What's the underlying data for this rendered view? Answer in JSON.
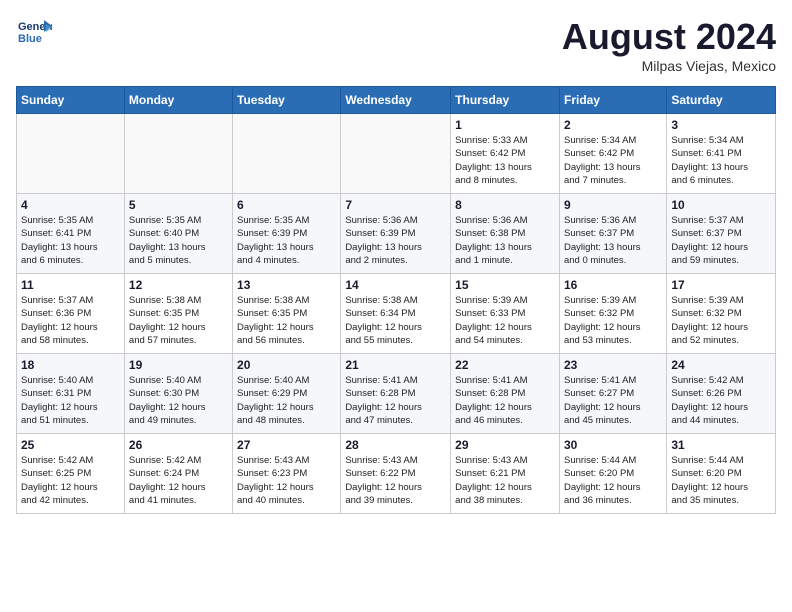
{
  "header": {
    "logo_text_line1": "General",
    "logo_text_line2": "Blue",
    "main_title": "August 2024",
    "subtitle": "Milpas Viejas, Mexico"
  },
  "days_of_week": [
    "Sunday",
    "Monday",
    "Tuesday",
    "Wednesday",
    "Thursday",
    "Friday",
    "Saturday"
  ],
  "weeks": [
    [
      {
        "num": "",
        "info": ""
      },
      {
        "num": "",
        "info": ""
      },
      {
        "num": "",
        "info": ""
      },
      {
        "num": "",
        "info": ""
      },
      {
        "num": "1",
        "info": "Sunrise: 5:33 AM\nSunset: 6:42 PM\nDaylight: 13 hours\nand 8 minutes."
      },
      {
        "num": "2",
        "info": "Sunrise: 5:34 AM\nSunset: 6:42 PM\nDaylight: 13 hours\nand 7 minutes."
      },
      {
        "num": "3",
        "info": "Sunrise: 5:34 AM\nSunset: 6:41 PM\nDaylight: 13 hours\nand 6 minutes."
      }
    ],
    [
      {
        "num": "4",
        "info": "Sunrise: 5:35 AM\nSunset: 6:41 PM\nDaylight: 13 hours\nand 6 minutes."
      },
      {
        "num": "5",
        "info": "Sunrise: 5:35 AM\nSunset: 6:40 PM\nDaylight: 13 hours\nand 5 minutes."
      },
      {
        "num": "6",
        "info": "Sunrise: 5:35 AM\nSunset: 6:39 PM\nDaylight: 13 hours\nand 4 minutes."
      },
      {
        "num": "7",
        "info": "Sunrise: 5:36 AM\nSunset: 6:39 PM\nDaylight: 13 hours\nand 2 minutes."
      },
      {
        "num": "8",
        "info": "Sunrise: 5:36 AM\nSunset: 6:38 PM\nDaylight: 13 hours\nand 1 minute."
      },
      {
        "num": "9",
        "info": "Sunrise: 5:36 AM\nSunset: 6:37 PM\nDaylight: 13 hours\nand 0 minutes."
      },
      {
        "num": "10",
        "info": "Sunrise: 5:37 AM\nSunset: 6:37 PM\nDaylight: 12 hours\nand 59 minutes."
      }
    ],
    [
      {
        "num": "11",
        "info": "Sunrise: 5:37 AM\nSunset: 6:36 PM\nDaylight: 12 hours\nand 58 minutes."
      },
      {
        "num": "12",
        "info": "Sunrise: 5:38 AM\nSunset: 6:35 PM\nDaylight: 12 hours\nand 57 minutes."
      },
      {
        "num": "13",
        "info": "Sunrise: 5:38 AM\nSunset: 6:35 PM\nDaylight: 12 hours\nand 56 minutes."
      },
      {
        "num": "14",
        "info": "Sunrise: 5:38 AM\nSunset: 6:34 PM\nDaylight: 12 hours\nand 55 minutes."
      },
      {
        "num": "15",
        "info": "Sunrise: 5:39 AM\nSunset: 6:33 PM\nDaylight: 12 hours\nand 54 minutes."
      },
      {
        "num": "16",
        "info": "Sunrise: 5:39 AM\nSunset: 6:32 PM\nDaylight: 12 hours\nand 53 minutes."
      },
      {
        "num": "17",
        "info": "Sunrise: 5:39 AM\nSunset: 6:32 PM\nDaylight: 12 hours\nand 52 minutes."
      }
    ],
    [
      {
        "num": "18",
        "info": "Sunrise: 5:40 AM\nSunset: 6:31 PM\nDaylight: 12 hours\nand 51 minutes."
      },
      {
        "num": "19",
        "info": "Sunrise: 5:40 AM\nSunset: 6:30 PM\nDaylight: 12 hours\nand 49 minutes."
      },
      {
        "num": "20",
        "info": "Sunrise: 5:40 AM\nSunset: 6:29 PM\nDaylight: 12 hours\nand 48 minutes."
      },
      {
        "num": "21",
        "info": "Sunrise: 5:41 AM\nSunset: 6:28 PM\nDaylight: 12 hours\nand 47 minutes."
      },
      {
        "num": "22",
        "info": "Sunrise: 5:41 AM\nSunset: 6:28 PM\nDaylight: 12 hours\nand 46 minutes."
      },
      {
        "num": "23",
        "info": "Sunrise: 5:41 AM\nSunset: 6:27 PM\nDaylight: 12 hours\nand 45 minutes."
      },
      {
        "num": "24",
        "info": "Sunrise: 5:42 AM\nSunset: 6:26 PM\nDaylight: 12 hours\nand 44 minutes."
      }
    ],
    [
      {
        "num": "25",
        "info": "Sunrise: 5:42 AM\nSunset: 6:25 PM\nDaylight: 12 hours\nand 42 minutes."
      },
      {
        "num": "26",
        "info": "Sunrise: 5:42 AM\nSunset: 6:24 PM\nDaylight: 12 hours\nand 41 minutes."
      },
      {
        "num": "27",
        "info": "Sunrise: 5:43 AM\nSunset: 6:23 PM\nDaylight: 12 hours\nand 40 minutes."
      },
      {
        "num": "28",
        "info": "Sunrise: 5:43 AM\nSunset: 6:22 PM\nDaylight: 12 hours\nand 39 minutes."
      },
      {
        "num": "29",
        "info": "Sunrise: 5:43 AM\nSunset: 6:21 PM\nDaylight: 12 hours\nand 38 minutes."
      },
      {
        "num": "30",
        "info": "Sunrise: 5:44 AM\nSunset: 6:20 PM\nDaylight: 12 hours\nand 36 minutes."
      },
      {
        "num": "31",
        "info": "Sunrise: 5:44 AM\nSunset: 6:20 PM\nDaylight: 12 hours\nand 35 minutes."
      }
    ]
  ]
}
